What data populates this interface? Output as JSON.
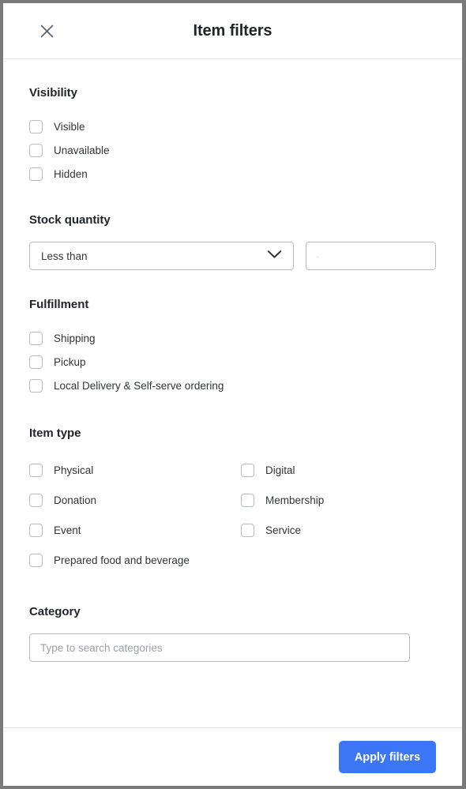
{
  "modal": {
    "title": "Item filters",
    "close_icon": "close-icon"
  },
  "sections": {
    "visibility": {
      "title": "Visibility",
      "options": [
        {
          "label": "Visible",
          "checked": false
        },
        {
          "label": "Unavailable",
          "checked": false
        },
        {
          "label": "Hidden",
          "checked": false
        }
      ]
    },
    "stock_quantity": {
      "title": "Stock quantity",
      "comparator": {
        "selected": "Less than",
        "chevron_icon": "chevron-down-icon"
      },
      "amount": {
        "value": "",
        "placeholder": "-"
      }
    },
    "fulfillment": {
      "title": "Fulfillment",
      "options": [
        {
          "label": "Shipping",
          "checked": false
        },
        {
          "label": "Pickup",
          "checked": false
        },
        {
          "label": "Local Delivery & Self-serve ordering",
          "checked": false
        }
      ]
    },
    "item_type": {
      "title": "Item type",
      "options_left": [
        {
          "label": "Physical",
          "checked": false
        },
        {
          "label": "Donation",
          "checked": false
        },
        {
          "label": "Event",
          "checked": false
        }
      ],
      "options_right": [
        {
          "label": "Digital",
          "checked": false
        },
        {
          "label": "Membership",
          "checked": false
        },
        {
          "label": "Service",
          "checked": false
        }
      ],
      "options_full": [
        {
          "label": "Prepared food and beverage",
          "checked": false
        }
      ]
    },
    "category": {
      "title": "Category",
      "search": {
        "value": "",
        "placeholder": "Type to search categories"
      }
    }
  },
  "footer": {
    "apply_label": "Apply filters"
  },
  "colors": {
    "accent": "#3a76f5",
    "text": "#21252b",
    "border": "#b6bcc4",
    "divider": "#e3e6ea"
  }
}
